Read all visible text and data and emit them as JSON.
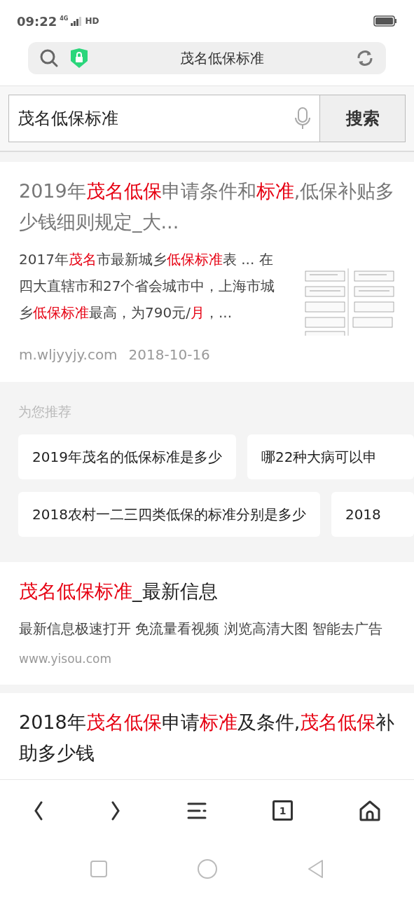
{
  "status_bar": {
    "time": "09:22",
    "network": "4G",
    "hd": "HD"
  },
  "address_bar": {
    "title": "茂名低保标准"
  },
  "search": {
    "value": "茂名低保标准",
    "button": "搜索"
  },
  "results": [
    {
      "title_muted": true,
      "title": [
        {
          "text": "2019年",
          "highlighted": false
        },
        {
          "text": "茂名低保",
          "highlighted": true
        },
        {
          "text": "申请条件和",
          "highlighted": false
        },
        {
          "text": "标准",
          "highlighted": true
        },
        {
          "text": ",低保补贴多少钱细则规定_大...",
          "highlighted": false
        }
      ],
      "snippet": [
        {
          "text": "2017年",
          "highlighted": false
        },
        {
          "text": "茂名",
          "highlighted": true
        },
        {
          "text": "市最新城乡",
          "highlighted": false
        },
        {
          "text": "低保标准",
          "highlighted": true
        },
        {
          "text": "表 ... 在四大直辖市和27个省会城市中，上海市城乡",
          "highlighted": false
        },
        {
          "text": "低保标准",
          "highlighted": true
        },
        {
          "text": "最高，为790元/",
          "highlighted": false
        },
        {
          "text": "月",
          "highlighted": true
        },
        {
          "text": "，...",
          "highlighted": false
        }
      ],
      "source": "m.wljyyjy.com",
      "date": "2018-10-16"
    },
    {
      "kind": "recommend",
      "heading": "为您推荐",
      "rows": [
        [
          "2019年茂名的低保标准是多少",
          "哪22种大病可以申"
        ],
        [
          "2018农村一二三四类低保的标准分别是多少",
          "2018"
        ]
      ]
    },
    {
      "kind": "text",
      "title_muted": false,
      "title": [
        {
          "text": "茂名低保标准",
          "highlighted": true
        },
        {
          "text": "_最新信息",
          "highlighted": false
        }
      ],
      "snippet": [
        {
          "text": "最新信息极速打开 免流量看视频 浏览高清大图 智能去广告",
          "highlighted": false
        }
      ],
      "source": "www.yisou.com"
    },
    {
      "kind": "title",
      "title_muted": false,
      "title": [
        {
          "text": "2018年",
          "highlighted": false
        },
        {
          "text": "茂名低保",
          "highlighted": true
        },
        {
          "text": "申请",
          "highlighted": false
        },
        {
          "text": "标准",
          "highlighted": true
        },
        {
          "text": "及条件,",
          "highlighted": false
        },
        {
          "text": "茂名低保",
          "highlighted": true
        },
        {
          "text": "补助多少钱",
          "highlighted": false
        }
      ]
    }
  ],
  "toolbar": {
    "tab_count": "1"
  }
}
